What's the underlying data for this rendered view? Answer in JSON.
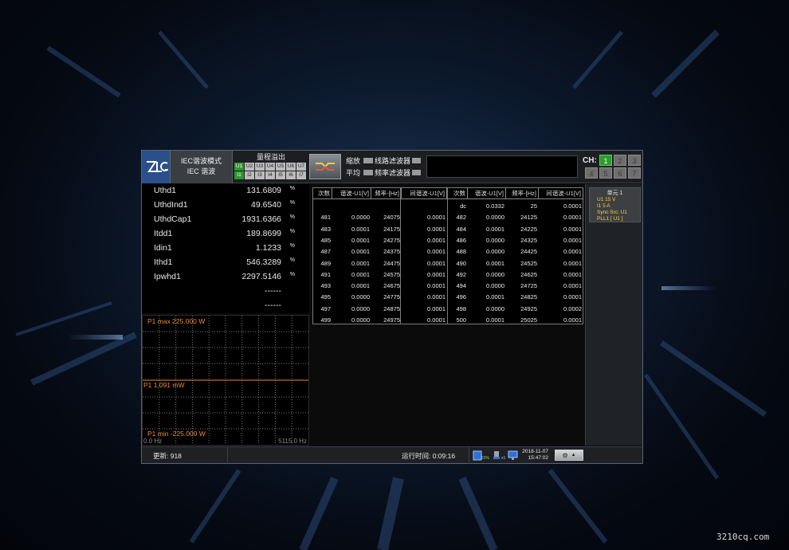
{
  "header": {
    "mode_line1": "IEC谐波模式",
    "mode_line2": "IEC 谐波",
    "overrange_title": "量程溢出",
    "overrange_u": [
      "U1",
      "U2",
      "U3",
      "U4",
      "U5",
      "U6",
      "U7"
    ],
    "overrange_i": [
      "I1",
      "I2",
      "I3",
      "I4",
      "I5",
      "I6",
      "I7"
    ],
    "overrange_active": "U1,I1",
    "zoom_label": "缩放",
    "avg_label": "平均",
    "line_filter_label": "线路滤波器",
    "freq_filter_label": "频率滤波器",
    "ch_label": "CH:",
    "ch_buttons": [
      "1",
      "2",
      "3",
      "4",
      "5",
      "6",
      "7"
    ],
    "ch_active": "1"
  },
  "measurements": [
    {
      "name": "Uthd1",
      "value": "131.6809",
      "unit": "%"
    },
    {
      "name": "UthdInd1",
      "value": "49.6540",
      "unit": "%"
    },
    {
      "name": "UthdCap1",
      "value": "1931.6366",
      "unit": "%"
    },
    {
      "name": "Itdd1",
      "value": "189.8699",
      "unit": "%"
    },
    {
      "name": "Idin1",
      "value": "1.1233",
      "unit": "%"
    },
    {
      "name": "Ithd1",
      "value": "546.3289",
      "unit": "%"
    },
    {
      "name": "Ipwhd1",
      "value": "2297.5146",
      "unit": "%"
    },
    {
      "name": "",
      "value": "------",
      "unit": ""
    },
    {
      "name": "",
      "value": "------",
      "unit": ""
    }
  ],
  "plot": {
    "max_label": "P1   max 225.000 W",
    "cur_label": "P1 1.091 mW",
    "min_label": "P1   min -225.000 W",
    "x_start": "0.0 Hz",
    "x_end": "5115.0 Hz"
  },
  "table": {
    "headers": [
      "次数",
      "谐波-U1[V]",
      "频率-[Hz]",
      "间谐波-U1[V]",
      "次数",
      "谐波-U1[V]",
      "频率-[Hz]",
      "间谐波-U1[V]"
    ],
    "rows": [
      [
        "",
        "",
        "",
        "",
        "dc",
        "0.0332",
        "25",
        "0.0001"
      ],
      [
        "481",
        "0.0000",
        "24075",
        "0.0001",
        "482",
        "0.0000",
        "24125",
        "0.0001"
      ],
      [
        "483",
        "0.0001",
        "24175",
        "0.0001",
        "484",
        "0.0001",
        "24225",
        "0.0001"
      ],
      [
        "485",
        "0.0001",
        "24275",
        "0.0001",
        "486",
        "0.0000",
        "24325",
        "0.0001"
      ],
      [
        "487",
        "0.0001",
        "24375",
        "0.0001",
        "488",
        "0.0000",
        "24425",
        "0.0001"
      ],
      [
        "489",
        "0.0001",
        "24475",
        "0.0001",
        "490",
        "0.0001",
        "24525",
        "0.0001"
      ],
      [
        "491",
        "0.0001",
        "24575",
        "0.0001",
        "492",
        "0.0000",
        "24625",
        "0.0001"
      ],
      [
        "493",
        "0.0001",
        "24675",
        "0.0001",
        "494",
        "0.0000",
        "24725",
        "0.0001"
      ],
      [
        "495",
        "0.0000",
        "24775",
        "0.0001",
        "496",
        "0.0001",
        "24825",
        "0.0001"
      ],
      [
        "497",
        "0.0000",
        "24875",
        "0.0001",
        "498",
        "0.0000",
        "24925",
        "0.0002"
      ],
      [
        "499",
        "0.0000",
        "24975",
        "0.0001",
        "500",
        "0.0001",
        "25025",
        "0.0001"
      ]
    ]
  },
  "unit_panel": {
    "title": "单元 1",
    "u_line": "U1        15 V",
    "i_line": "I1          5 A",
    "sync": "Sync Src: U1",
    "pll": "PLL1 [ U1 ]"
  },
  "status": {
    "update": "更新: 918",
    "runtime": "运行时间: 0:09:16",
    "disk_pct": "60%",
    "usb": "x1",
    "date": "2018-11-07",
    "time": "15:47:02"
  },
  "watermark": "3210cq.com",
  "colors": {
    "accent_green": "#2d9a2d",
    "plot_orange": "#e98a3a",
    "unit_yellow": "#ffd23a"
  }
}
